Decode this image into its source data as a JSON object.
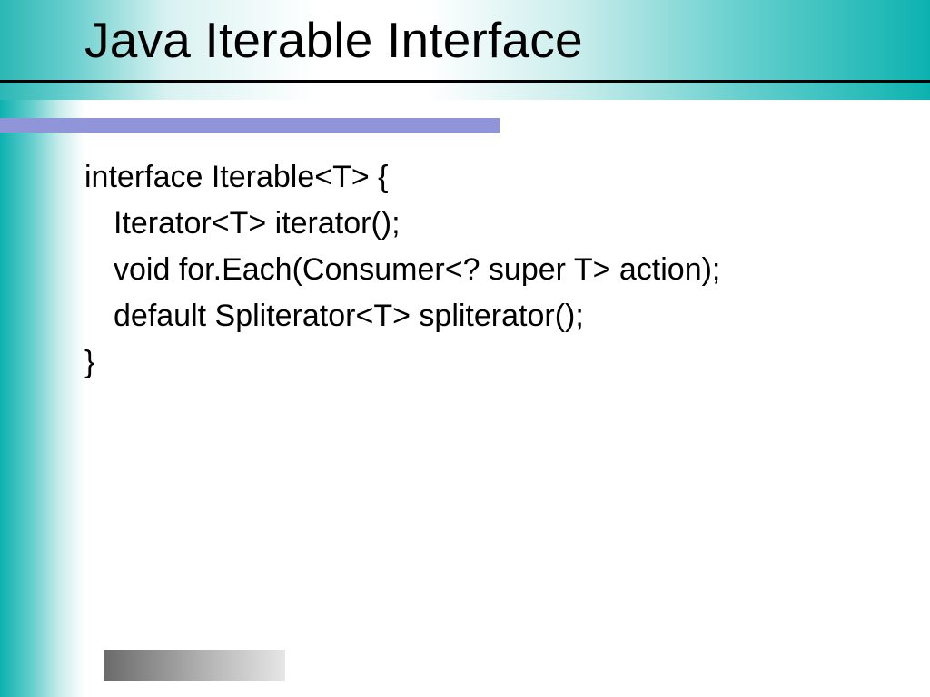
{
  "title": "Java Iterable Interface",
  "code": {
    "line1": "interface Iterable<T> {",
    "line2": "Iterator<T> iterator();",
    "line3": "void for.Each(Consumer<? super T> action);",
    "line4": "default Spliterator<T> spliterator();",
    "line5": "}"
  }
}
